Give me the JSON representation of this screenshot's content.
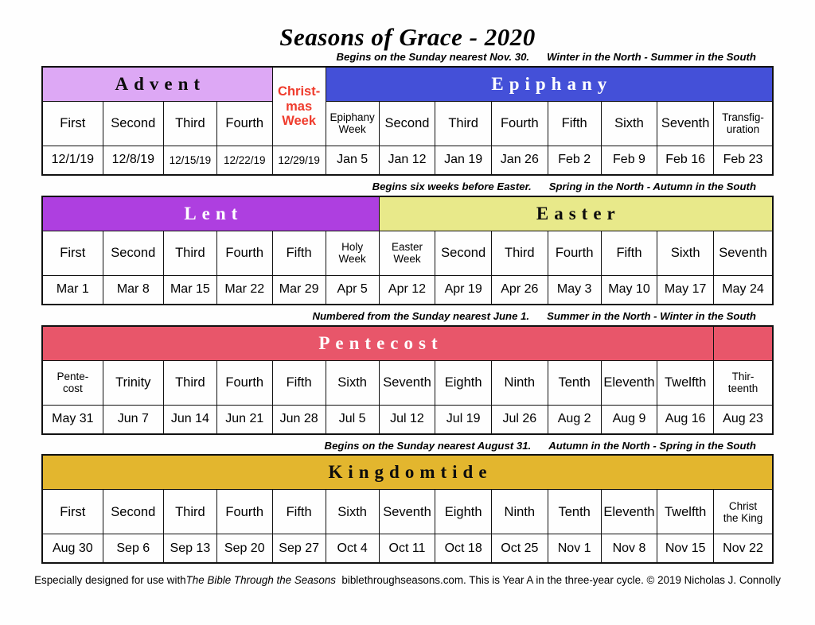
{
  "title": "Seasons of Grace - 2020",
  "colors": {
    "advent": "#DDA8F5",
    "christmas": "#FEFEFE",
    "christmas_text": "#EF3B2C",
    "epiphany": "#4450D8",
    "lent": "#AE3FE0",
    "easter": "#E8E98A",
    "pentecost": "#E8566A",
    "kingdomtide": "#E3B62E",
    "border": "#111111",
    "page_bg": "#FEFEFE"
  },
  "sections": [
    {
      "id": "advent-epiphany",
      "caption_a": "Begins on the Sunday nearest Nov. 30.",
      "caption_b": "Winter in the North - Summer in the South",
      "banners": [
        {
          "label": "Advent",
          "span": 4,
          "color": "#DDA8F5",
          "text": "dark"
        },
        {
          "label": "",
          "span": 1,
          "color": "#FEFEFE",
          "text": "dark",
          "merged_with_below": true
        },
        {
          "label": "Epiphany",
          "span": 8,
          "color": "#4450D8",
          "text": "light"
        }
      ],
      "christmas_cell": {
        "label": "Christ-\nmas\nWeek",
        "rowspan": 2
      },
      "names": [
        "First",
        "Second",
        "Third",
        "Fourth",
        "Epiphany\nWeek",
        "Second",
        "Third",
        "Fourth",
        "Fifth",
        "Sixth",
        "Seventh",
        "Transfig-\nuration"
      ],
      "dates": [
        "12/1/19",
        "12/8/19",
        "12/15/19",
        "12/22/19",
        "12/29/19",
        "Jan 5",
        "Jan 12",
        "Jan 19",
        "Jan 26",
        "Feb 2",
        "Feb 9",
        "Feb 16",
        "Feb 23"
      ]
    },
    {
      "id": "lent-easter",
      "caption_a": "Begins six weeks before Easter.",
      "caption_b": "Spring in the North - Autumn in the South",
      "banners": [
        {
          "label": "Lent",
          "span": 6,
          "color": "#AE3FE0",
          "text": "light"
        },
        {
          "label": "Easter",
          "span": 7,
          "color": "#E8E98A",
          "text": "dark"
        }
      ],
      "names": [
        "First",
        "Second",
        "Third",
        "Fourth",
        "Fifth",
        "Holy\nWeek",
        "Easter\nWeek",
        "Second",
        "Third",
        "Fourth",
        "Fifth",
        "Sixth",
        "Seventh"
      ],
      "dates": [
        "Mar 1",
        "Mar 8",
        "Mar 15",
        "Mar 22",
        "Mar 29",
        "Apr 5",
        "Apr 12",
        "Apr 19",
        "Apr 26",
        "May 3",
        "May 10",
        "May 17",
        "May 24"
      ]
    },
    {
      "id": "pentecost",
      "caption_a": "Numbered from the Sunday nearest June 1.",
      "caption_b": "Summer in the North - Winter in the South",
      "banners": [
        {
          "label": "Pentecost",
          "span": 12,
          "color": "#E8566A",
          "text": "light"
        },
        {
          "label": "",
          "span": 1,
          "color": "#E8566A",
          "text": "light"
        }
      ],
      "names": [
        "Pente-\ncost",
        "Trinity",
        "Third",
        "Fourth",
        "Fifth",
        "Sixth",
        "Seventh",
        "Eighth",
        "Ninth",
        "Tenth",
        "Eleventh",
        "Twelfth",
        "Thir-\nteenth"
      ],
      "dates": [
        "May 31",
        "Jun 7",
        "Jun 14",
        "Jun 21",
        "Jun 28",
        "Jul 5",
        "Jul 12",
        "Jul 19",
        "Jul 26",
        "Aug 2",
        "Aug 9",
        "Aug 16",
        "Aug 23"
      ]
    },
    {
      "id": "kingdomtide",
      "caption_a": "Begins on the Sunday nearest August 31.",
      "caption_b": "Autumn in the North - Spring in the South",
      "banners": [
        {
          "label": "Kingdomtide",
          "span": 13,
          "color": "#E3B62E",
          "text": "dark"
        }
      ],
      "names": [
        "First",
        "Second",
        "Third",
        "Fourth",
        "Fifth",
        "Sixth",
        "Seventh",
        "Eighth",
        "Ninth",
        "Tenth",
        "Eleventh",
        "Twelfth",
        "Christ\nthe King"
      ],
      "dates": [
        "Aug 30",
        "Sep 6",
        "Sep 13",
        "Sep 20",
        "Sep 27",
        "Oct 4",
        "Oct 11",
        "Oct 18",
        "Oct 25",
        "Nov 1",
        "Nov 8",
        "Nov 15",
        "Nov 22"
      ]
    }
  ],
  "footer": {
    "part1": "Especially designed for use with",
    "book_title": "The Bible Through the Seasons",
    "part2": "biblethroughseasons.com. This is Year A in the three-year cycle. © 2019 Nicholas J. Connolly"
  }
}
